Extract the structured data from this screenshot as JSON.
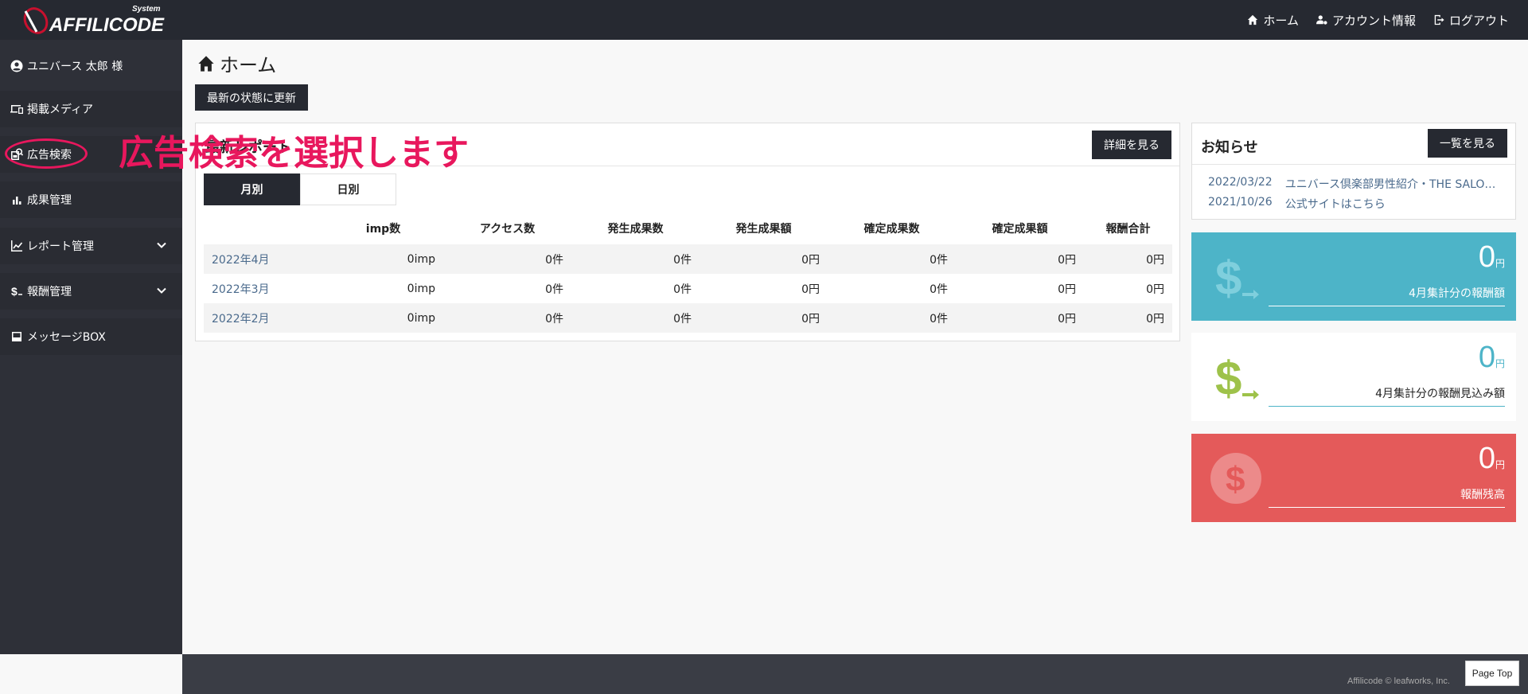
{
  "header": {
    "brand": "AFFILICODE",
    "brand_sub": "System",
    "nav": [
      {
        "label": "ホーム",
        "icon": "home-icon"
      },
      {
        "label": "アカウント情報",
        "icon": "user-gear-icon"
      },
      {
        "label": "ログアウト",
        "icon": "logout-icon"
      }
    ]
  },
  "sidebar": {
    "user": "ユニバース 太郎 様",
    "items": [
      {
        "label": "掲載メディア",
        "icon": "devices-icon"
      },
      {
        "label": "広告検索",
        "icon": "ad-search-icon"
      },
      {
        "label": "成果管理",
        "icon": "bar-chart-icon"
      },
      {
        "label": "レポート管理",
        "icon": "line-chart-icon"
      },
      {
        "label": "報酬管理",
        "icon": "dollar-icon"
      },
      {
        "label": "メッセージBOX",
        "icon": "inbox-icon"
      }
    ]
  },
  "main": {
    "page_title": "ホーム",
    "refresh_label": "最新の状態に更新",
    "panel": {
      "title": "最新レポート",
      "detail_label": "詳細を見る",
      "tabs": [
        "月別",
        "日別"
      ],
      "columns": [
        "",
        "imp数",
        "アクセス数",
        "発生成果数",
        "発生成果額",
        "確定成果数",
        "確定成果額",
        "報酬合計"
      ],
      "rows": [
        [
          "2022年4月",
          "0imp",
          "0件",
          "0件",
          "0円",
          "0件",
          "0円",
          "0円"
        ],
        [
          "2022年3月",
          "0imp",
          "0件",
          "0件",
          "0円",
          "0件",
          "0円",
          "0円"
        ],
        [
          "2022年2月",
          "0imp",
          "0件",
          "0件",
          "0円",
          "0件",
          "0円",
          "0円"
        ]
      ]
    }
  },
  "notice": {
    "title": "お知らせ",
    "list_label": "一覧を見る",
    "items": [
      {
        "date": "2022/03/22",
        "text": "ユニバース倶楽部男性紹介・THE SALO…"
      },
      {
        "date": "2021/10/26",
        "text": "公式サイトはこちら"
      }
    ]
  },
  "cards": [
    {
      "amount": "0",
      "unit": "円",
      "label": "4月集計分の報酬額",
      "color": "#4db4c8"
    },
    {
      "amount": "0",
      "unit": "円",
      "label": "4月集計分の報酬見込み額",
      "color": "#ffffff"
    },
    {
      "amount": "0",
      "unit": "円",
      "label": "報酬残高",
      "color": "#e45a5a"
    }
  ],
  "annotation": {
    "text": "広告検索を選択します",
    "color": "#e8175d"
  },
  "footer": {
    "copyright": "Affilicode © leafworks, Inc.",
    "page_top": "Page Top"
  }
}
